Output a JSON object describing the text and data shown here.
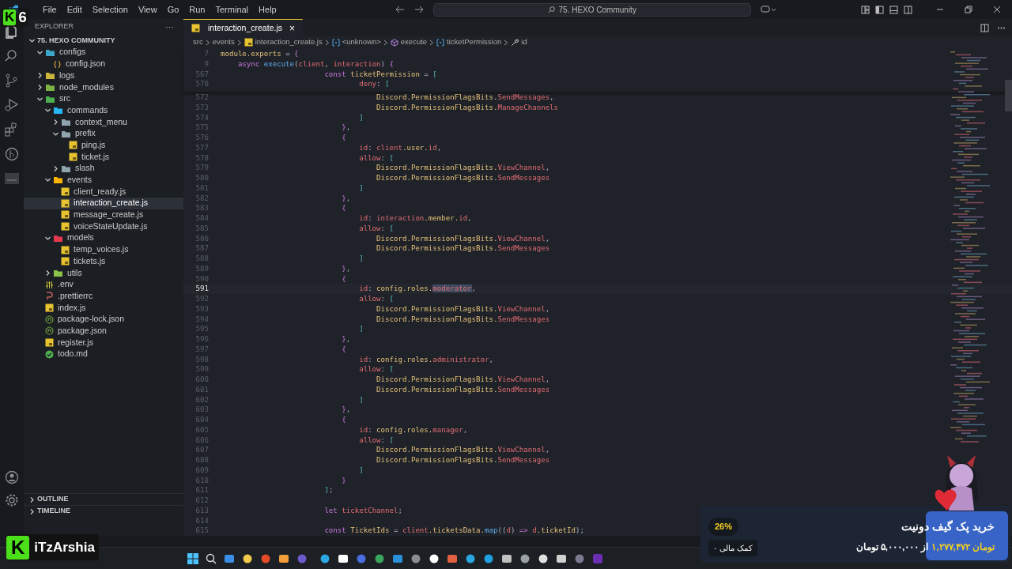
{
  "overlay": {
    "logo_letter": "K",
    "logo_number": "6",
    "channel_letter": "K",
    "channel_name": "iTzArshia"
  },
  "menu": [
    "File",
    "Edit",
    "Selection",
    "View",
    "Go",
    "Run",
    "Terminal",
    "Help"
  ],
  "command_center": {
    "text": "75. HEXO Community"
  },
  "sidebar": {
    "title": "EXPLORER",
    "more": "···",
    "root": {
      "label": "75. HEXO COMMUNITY",
      "expanded": true
    },
    "items": [
      {
        "label": "configs",
        "kind": "folder",
        "color": "#3aa7c9",
        "expanded": true,
        "selected": false,
        "children": [
          {
            "label": "config.json",
            "kind": "json",
            "selected": false
          }
        ]
      },
      {
        "label": "logs",
        "kind": "folder",
        "color": "#c9b63a",
        "expanded": false,
        "selected": false
      },
      {
        "label": "node_modules",
        "kind": "folder",
        "color": "#7cb342",
        "expanded": false,
        "selected": false
      },
      {
        "label": "src",
        "kind": "folder",
        "color": "#4caf50",
        "expanded": true,
        "selected": false,
        "children": [
          {
            "label": "commands",
            "kind": "folder",
            "color": "#29b6f6",
            "expanded": true,
            "selected": false,
            "children": [
              {
                "label": "context_menu",
                "kind": "folder",
                "color": "#90a4ae",
                "expanded": false,
                "selected": false
              },
              {
                "label": "prefix",
                "kind": "folder",
                "color": "#90a4ae",
                "expanded": true,
                "selected": false,
                "children": [
                  {
                    "label": "ping.js",
                    "kind": "js",
                    "selected": false
                  },
                  {
                    "label": "ticket.js",
                    "kind": "js",
                    "selected": false
                  }
                ]
              },
              {
                "label": "slash",
                "kind": "folder",
                "color": "#90a4ae",
                "expanded": false,
                "selected": false
              }
            ]
          },
          {
            "label": "events",
            "kind": "folder",
            "color": "#ffb300",
            "expanded": true,
            "selected": false,
            "children": [
              {
                "label": "client_ready.js",
                "kind": "js",
                "selected": false
              },
              {
                "label": "interaction_create.js",
                "kind": "js",
                "selected": true
              },
              {
                "label": "message_create.js",
                "kind": "js",
                "selected": false
              },
              {
                "label": "voiceStateUpdate.js",
                "kind": "js",
                "selected": false
              }
            ]
          },
          {
            "label": "models",
            "kind": "folder",
            "color": "#e53950",
            "expanded": true,
            "selected": false,
            "children": [
              {
                "label": "temp_voices.js",
                "kind": "js",
                "selected": false
              },
              {
                "label": "tickets.js",
                "kind": "js",
                "selected": false
              }
            ]
          },
          {
            "label": "utils",
            "kind": "folder",
            "color": "#8bc34a",
            "expanded": false,
            "selected": false
          }
        ]
      },
      {
        "label": ".env",
        "kind": "env",
        "selected": false
      },
      {
        "label": ".prettierrc",
        "kind": "prettier",
        "selected": false
      },
      {
        "label": "index.js",
        "kind": "js",
        "selected": false
      },
      {
        "label": "package-lock.json",
        "kind": "npm",
        "selected": false
      },
      {
        "label": "package.json",
        "kind": "npm",
        "selected": false
      },
      {
        "label": "register.js",
        "kind": "js",
        "selected": false
      },
      {
        "label": "todo.md",
        "kind": "todo",
        "selected": false
      }
    ],
    "sections": [
      {
        "label": "OUTLINE",
        "expanded": false
      },
      {
        "label": "TIMELINE",
        "expanded": false
      }
    ]
  },
  "tabs": [
    {
      "label": "interaction_create.js",
      "selected": true,
      "close": "×"
    }
  ],
  "breadcrumbs": [
    {
      "label": "src",
      "kind": "folder"
    },
    {
      "label": "events",
      "kind": "folder"
    },
    {
      "label": "interaction_create.js",
      "kind": "js"
    },
    {
      "label": "<unknown>",
      "kind": "module"
    },
    {
      "label": "execute",
      "kind": "method"
    },
    {
      "label": "ticketPermission",
      "kind": "variable"
    },
    {
      "label": "id",
      "kind": "property"
    }
  ],
  "code": {
    "sticky": [
      {
        "number": "7",
        "tokens": [
          {
            "kind": "ident",
            "text": "module.exports"
          },
          {
            "kind": "punct",
            "text": " = "
          },
          {
            "kind": "brace",
            "text": "{"
          }
        ]
      },
      {
        "number": "9",
        "tokens": [
          {
            "kind": "keyword",
            "text": "    async "
          },
          {
            "kind": "function",
            "text": "execute"
          },
          {
            "kind": "punct",
            "text": "("
          },
          {
            "kind": "member",
            "text": "client"
          },
          {
            "kind": "punct",
            "text": ", "
          },
          {
            "kind": "member",
            "text": "interaction"
          },
          {
            "kind": "punct",
            "text": ") "
          },
          {
            "kind": "brace",
            "text": "{"
          }
        ]
      },
      {
        "number": "567",
        "tokens": [
          {
            "kind": "keyword",
            "text": "                        const"
          },
          {
            "kind": "ident",
            "text": " ticketPermission"
          },
          {
            "kind": "punct",
            "text": " = "
          },
          {
            "kind": "bracket",
            "text": "["
          }
        ]
      },
      {
        "number": "570",
        "tokens": [
          {
            "kind": "member",
            "text": "                                deny"
          },
          {
            "kind": "punct",
            "text": ": "
          },
          {
            "kind": "bracket",
            "text": "["
          }
        ]
      }
    ],
    "lines": [
      {
        "number": "572",
        "current": false,
        "tokens": [
          {
            "kind": "ident",
            "text": "                                    Discord.PermissionFlagsBits."
          },
          {
            "kind": "member",
            "text": "SendMessages"
          },
          {
            "kind": "punct",
            "text": ","
          }
        ]
      },
      {
        "number": "573",
        "current": false,
        "tokens": [
          {
            "kind": "ident",
            "text": "                                    Discord.PermissionFlagsBits."
          },
          {
            "kind": "member",
            "text": "ManageChannels"
          }
        ]
      },
      {
        "number": "574",
        "current": false,
        "tokens": [
          {
            "kind": "bracket",
            "text": "                                ]"
          }
        ]
      },
      {
        "number": "575",
        "current": false,
        "tokens": [
          {
            "kind": "brace",
            "text": "                            }"
          },
          {
            "kind": "punct",
            "text": ","
          }
        ]
      },
      {
        "number": "576",
        "current": false,
        "tokens": [
          {
            "kind": "brace",
            "text": "                            {"
          }
        ]
      },
      {
        "number": "577",
        "current": false,
        "tokens": [
          {
            "kind": "member",
            "text": "                                id"
          },
          {
            "kind": "punct",
            "text": ": "
          },
          {
            "kind": "member",
            "text": "client"
          },
          {
            "kind": "ident",
            "text": ".user."
          },
          {
            "kind": "member",
            "text": "id"
          },
          {
            "kind": "punct",
            "text": ","
          }
        ]
      },
      {
        "number": "578",
        "current": false,
        "tokens": [
          {
            "kind": "member",
            "text": "                                allow"
          },
          {
            "kind": "punct",
            "text": ": "
          },
          {
            "kind": "bracket",
            "text": "["
          }
        ]
      },
      {
        "number": "579",
        "current": false,
        "tokens": [
          {
            "kind": "ident",
            "text": "                                    Discord.PermissionFlagsBits."
          },
          {
            "kind": "member",
            "text": "ViewChannel"
          },
          {
            "kind": "punct",
            "text": ","
          }
        ]
      },
      {
        "number": "580",
        "current": false,
        "tokens": [
          {
            "kind": "ident",
            "text": "                                    Discord.PermissionFlagsBits."
          },
          {
            "kind": "member",
            "text": "SendMessages"
          }
        ]
      },
      {
        "number": "581",
        "current": false,
        "tokens": [
          {
            "kind": "bracket",
            "text": "                                ]"
          }
        ]
      },
      {
        "number": "582",
        "current": false,
        "tokens": [
          {
            "kind": "brace",
            "text": "                            }"
          },
          {
            "kind": "punct",
            "text": ","
          }
        ]
      },
      {
        "number": "583",
        "current": false,
        "tokens": [
          {
            "kind": "brace",
            "text": "                            {"
          }
        ]
      },
      {
        "number": "584",
        "current": false,
        "tokens": [
          {
            "kind": "member",
            "text": "                                id"
          },
          {
            "kind": "punct",
            "text": ": "
          },
          {
            "kind": "member",
            "text": "interaction"
          },
          {
            "kind": "ident",
            "text": ".member."
          },
          {
            "kind": "member",
            "text": "id"
          },
          {
            "kind": "punct",
            "text": ","
          }
        ]
      },
      {
        "number": "585",
        "current": false,
        "tokens": [
          {
            "kind": "member",
            "text": "                                allow"
          },
          {
            "kind": "punct",
            "text": ": "
          },
          {
            "kind": "bracket",
            "text": "["
          }
        ]
      },
      {
        "number": "586",
        "current": false,
        "tokens": [
          {
            "kind": "ident",
            "text": "                                    Discord.PermissionFlagsBits."
          },
          {
            "kind": "member",
            "text": "ViewChannel"
          },
          {
            "kind": "punct",
            "text": ","
          }
        ]
      },
      {
        "number": "587",
        "current": false,
        "tokens": [
          {
            "kind": "ident",
            "text": "                                    Discord.PermissionFlagsBits."
          },
          {
            "kind": "member",
            "text": "SendMessages"
          }
        ]
      },
      {
        "number": "588",
        "current": false,
        "tokens": [
          {
            "kind": "bracket",
            "text": "                                ]"
          }
        ]
      },
      {
        "number": "589",
        "current": false,
        "tokens": [
          {
            "kind": "brace",
            "text": "                            }"
          },
          {
            "kind": "punct",
            "text": ","
          }
        ]
      },
      {
        "number": "590",
        "current": false,
        "tokens": [
          {
            "kind": "brace",
            "text": "                            {"
          }
        ]
      },
      {
        "number": "591",
        "current": true,
        "tokens": [
          {
            "kind": "member",
            "text": "                                id"
          },
          {
            "kind": "punct",
            "text": ": "
          },
          {
            "kind": "ident",
            "text": "config.roles."
          },
          {
            "kind": "highlight",
            "text": "moderator"
          },
          {
            "kind": "punct",
            "text": ","
          }
        ]
      },
      {
        "number": "592",
        "current": false,
        "tokens": [
          {
            "kind": "member",
            "text": "                                allow"
          },
          {
            "kind": "punct",
            "text": ": "
          },
          {
            "kind": "bracket",
            "text": "["
          }
        ]
      },
      {
        "number": "593",
        "current": false,
        "tokens": [
          {
            "kind": "ident",
            "text": "                                    Discord.PermissionFlagsBits."
          },
          {
            "kind": "member",
            "text": "ViewChannel"
          },
          {
            "kind": "punct",
            "text": ","
          }
        ]
      },
      {
        "number": "594",
        "current": false,
        "tokens": [
          {
            "kind": "ident",
            "text": "                                    Discord.PermissionFlagsBits."
          },
          {
            "kind": "member",
            "text": "SendMessages"
          }
        ]
      },
      {
        "number": "595",
        "current": false,
        "tokens": [
          {
            "kind": "bracket",
            "text": "                                ]"
          }
        ]
      },
      {
        "number": "596",
        "current": false,
        "tokens": [
          {
            "kind": "brace",
            "text": "                            }"
          },
          {
            "kind": "punct",
            "text": ","
          }
        ]
      },
      {
        "number": "597",
        "current": false,
        "tokens": [
          {
            "kind": "brace",
            "text": "                            {"
          }
        ]
      },
      {
        "number": "598",
        "current": false,
        "tokens": [
          {
            "kind": "member",
            "text": "                                id"
          },
          {
            "kind": "punct",
            "text": ": "
          },
          {
            "kind": "ident",
            "text": "config.roles."
          },
          {
            "kind": "member",
            "text": "administrator"
          },
          {
            "kind": "punct",
            "text": ","
          }
        ]
      },
      {
        "number": "599",
        "current": false,
        "tokens": [
          {
            "kind": "member",
            "text": "                                allow"
          },
          {
            "kind": "punct",
            "text": ": "
          },
          {
            "kind": "bracket",
            "text": "["
          }
        ]
      },
      {
        "number": "600",
        "current": false,
        "tokens": [
          {
            "kind": "ident",
            "text": "                                    Discord.PermissionFlagsBits."
          },
          {
            "kind": "member",
            "text": "ViewChannel"
          },
          {
            "kind": "punct",
            "text": ","
          }
        ]
      },
      {
        "number": "601",
        "current": false,
        "tokens": [
          {
            "kind": "ident",
            "text": "                                    Discord.PermissionFlagsBits."
          },
          {
            "kind": "member",
            "text": "SendMessages"
          }
        ]
      },
      {
        "number": "602",
        "current": false,
        "tokens": [
          {
            "kind": "bracket",
            "text": "                                ]"
          }
        ]
      },
      {
        "number": "603",
        "current": false,
        "tokens": [
          {
            "kind": "brace",
            "text": "                            }"
          },
          {
            "kind": "punct",
            "text": ","
          }
        ]
      },
      {
        "number": "604",
        "current": false,
        "tokens": [
          {
            "kind": "brace",
            "text": "                            {"
          }
        ]
      },
      {
        "number": "605",
        "current": false,
        "tokens": [
          {
            "kind": "member",
            "text": "                                id"
          },
          {
            "kind": "punct",
            "text": ": "
          },
          {
            "kind": "ident",
            "text": "config.roles."
          },
          {
            "kind": "member",
            "text": "manager"
          },
          {
            "kind": "punct",
            "text": ","
          }
        ]
      },
      {
        "number": "606",
        "current": false,
        "tokens": [
          {
            "kind": "member",
            "text": "                                allow"
          },
          {
            "kind": "punct",
            "text": ": "
          },
          {
            "kind": "bracket",
            "text": "["
          }
        ]
      },
      {
        "number": "607",
        "current": false,
        "tokens": [
          {
            "kind": "ident",
            "text": "                                    Discord.PermissionFlagsBits."
          },
          {
            "kind": "member",
            "text": "ViewChannel"
          },
          {
            "kind": "punct",
            "text": ","
          }
        ]
      },
      {
        "number": "608",
        "current": false,
        "tokens": [
          {
            "kind": "ident",
            "text": "                                    Discord.PermissionFlagsBits."
          },
          {
            "kind": "member",
            "text": "SendMessages"
          }
        ]
      },
      {
        "number": "609",
        "current": false,
        "tokens": [
          {
            "kind": "bracket",
            "text": "                                ]"
          }
        ]
      },
      {
        "number": "610",
        "current": false,
        "tokens": [
          {
            "kind": "brace",
            "text": "                            }"
          }
        ]
      },
      {
        "number": "611",
        "current": false,
        "tokens": [
          {
            "kind": "bracket",
            "text": "                        ]"
          },
          {
            "kind": "punct",
            "text": ";"
          }
        ]
      },
      {
        "number": "612",
        "current": false
      },
      {
        "number": "613",
        "current": false,
        "tokens": [
          {
            "kind": "keyword",
            "text": "                        let"
          },
          {
            "kind": "member",
            "text": " ticketChannel"
          },
          {
            "kind": "punct",
            "text": ";"
          }
        ]
      },
      {
        "number": "614",
        "current": false
      },
      {
        "number": "615",
        "current": false,
        "tokens": [
          {
            "kind": "keyword",
            "text": "                        const"
          },
          {
            "kind": "ident",
            "text": " TicketIds"
          },
          {
            "kind": "punct",
            "text": " = "
          },
          {
            "kind": "member",
            "text": "client"
          },
          {
            "kind": "ident",
            "text": ".ticketsData."
          },
          {
            "kind": "function",
            "text": "map"
          },
          {
            "kind": "punct",
            "text": "(("
          },
          {
            "kind": "member",
            "text": "d"
          },
          {
            "kind": "punct",
            "text": ") "
          },
          {
            "kind": "keyword",
            "text": "=> "
          },
          {
            "kind": "member",
            "text": "d"
          },
          {
            "kind": "ident",
            "text": ".ticketId"
          },
          {
            "kind": "punct",
            "text": ");"
          }
        ]
      }
    ]
  },
  "donation": {
    "title": "خرید پک گیف دونیت",
    "raised": "۱,۲۷۷,۴۷۲ تومان",
    "goal": "از ۵,۰۰۰,۰۰۰ تومان",
    "percent": "26%",
    "supporters": "۰ کمک مالی"
  }
}
